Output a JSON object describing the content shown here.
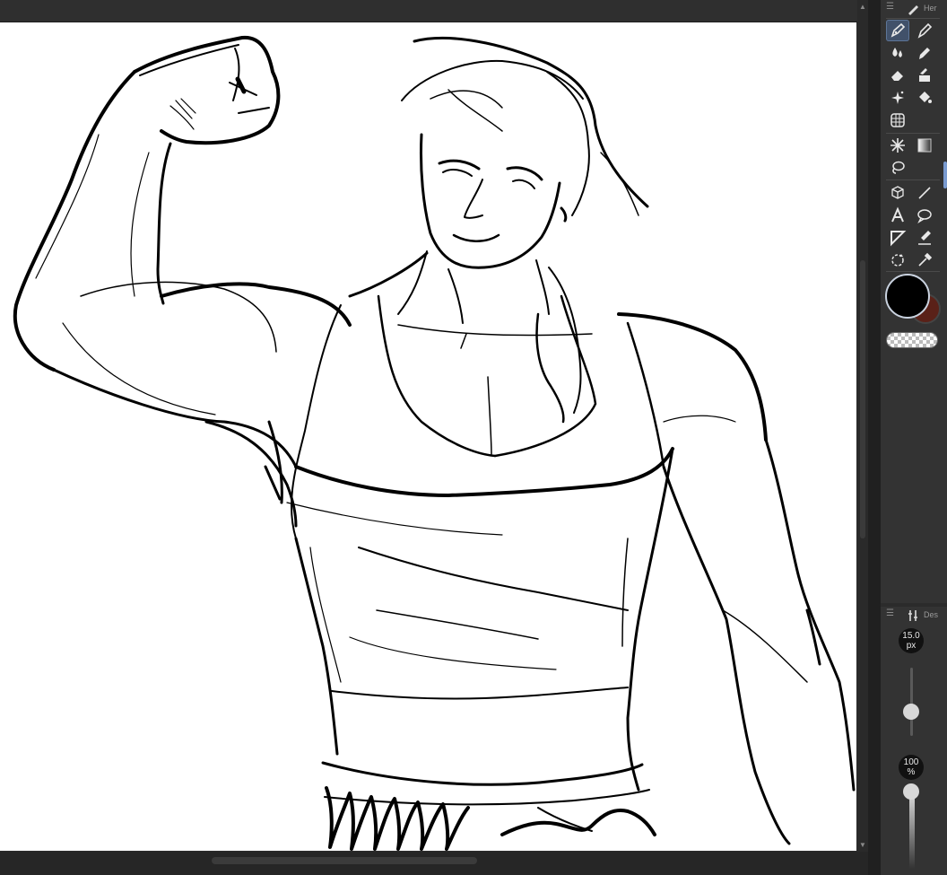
{
  "tool_panel": {
    "title": "Her",
    "tools": [
      {
        "name": "pen-tool",
        "active": true
      },
      {
        "name": "brush-tool",
        "active": false
      },
      {
        "name": "blur-tool",
        "active": false
      },
      {
        "name": "marker-tool",
        "active": false
      },
      {
        "name": "eraser-tool",
        "active": false
      },
      {
        "name": "fill-tool",
        "active": false
      },
      {
        "name": "sparkle-tool",
        "active": false
      },
      {
        "name": "bucket-tool",
        "active": false
      },
      {
        "name": "grid-tool",
        "active": false
      },
      {
        "name": "magic-wand-tool",
        "active": false
      },
      {
        "name": "gradient-tool",
        "active": false
      },
      {
        "name": "lasso-tool",
        "active": false
      },
      {
        "name": "cube-tool",
        "active": false
      },
      {
        "name": "line-tool",
        "active": false
      },
      {
        "name": "text-tool",
        "active": false
      },
      {
        "name": "speech-bubble-tool",
        "active": false
      },
      {
        "name": "frame-tool",
        "active": false
      },
      {
        "name": "correction-tool",
        "active": false
      },
      {
        "name": "rotate-tool",
        "active": false
      },
      {
        "name": "eyedropper-tool",
        "active": false
      }
    ],
    "colors": {
      "foreground": "#000000",
      "background": "#5a2118"
    }
  },
  "brush_panel": {
    "title": "Des",
    "size_value": "15.0",
    "size_unit": "px",
    "size_level": 0.35,
    "opacity_value": "100",
    "opacity_unit": "%",
    "opacity_level": 1.0
  }
}
